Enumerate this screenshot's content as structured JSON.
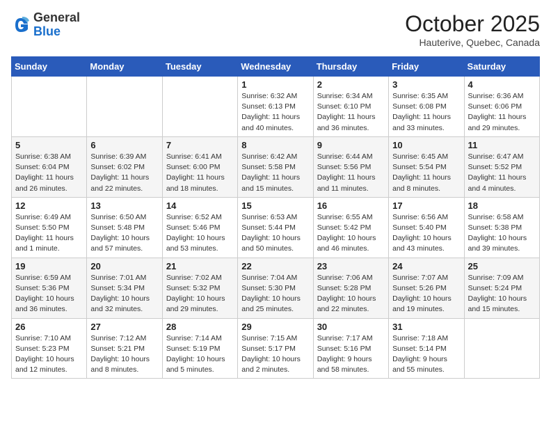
{
  "header": {
    "logo_general": "General",
    "logo_blue": "Blue",
    "month": "October 2025",
    "location": "Hauterive, Quebec, Canada"
  },
  "weekdays": [
    "Sunday",
    "Monday",
    "Tuesday",
    "Wednesday",
    "Thursday",
    "Friday",
    "Saturday"
  ],
  "weeks": [
    [
      {
        "day": "",
        "info": ""
      },
      {
        "day": "",
        "info": ""
      },
      {
        "day": "",
        "info": ""
      },
      {
        "day": "1",
        "info": "Sunrise: 6:32 AM\nSunset: 6:13 PM\nDaylight: 11 hours\nand 40 minutes."
      },
      {
        "day": "2",
        "info": "Sunrise: 6:34 AM\nSunset: 6:10 PM\nDaylight: 11 hours\nand 36 minutes."
      },
      {
        "day": "3",
        "info": "Sunrise: 6:35 AM\nSunset: 6:08 PM\nDaylight: 11 hours\nand 33 minutes."
      },
      {
        "day": "4",
        "info": "Sunrise: 6:36 AM\nSunset: 6:06 PM\nDaylight: 11 hours\nand 29 minutes."
      }
    ],
    [
      {
        "day": "5",
        "info": "Sunrise: 6:38 AM\nSunset: 6:04 PM\nDaylight: 11 hours\nand 26 minutes."
      },
      {
        "day": "6",
        "info": "Sunrise: 6:39 AM\nSunset: 6:02 PM\nDaylight: 11 hours\nand 22 minutes."
      },
      {
        "day": "7",
        "info": "Sunrise: 6:41 AM\nSunset: 6:00 PM\nDaylight: 11 hours\nand 18 minutes."
      },
      {
        "day": "8",
        "info": "Sunrise: 6:42 AM\nSunset: 5:58 PM\nDaylight: 11 hours\nand 15 minutes."
      },
      {
        "day": "9",
        "info": "Sunrise: 6:44 AM\nSunset: 5:56 PM\nDaylight: 11 hours\nand 11 minutes."
      },
      {
        "day": "10",
        "info": "Sunrise: 6:45 AM\nSunset: 5:54 PM\nDaylight: 11 hours\nand 8 minutes."
      },
      {
        "day": "11",
        "info": "Sunrise: 6:47 AM\nSunset: 5:52 PM\nDaylight: 11 hours\nand 4 minutes."
      }
    ],
    [
      {
        "day": "12",
        "info": "Sunrise: 6:49 AM\nSunset: 5:50 PM\nDaylight: 11 hours\nand 1 minute."
      },
      {
        "day": "13",
        "info": "Sunrise: 6:50 AM\nSunset: 5:48 PM\nDaylight: 10 hours\nand 57 minutes."
      },
      {
        "day": "14",
        "info": "Sunrise: 6:52 AM\nSunset: 5:46 PM\nDaylight: 10 hours\nand 53 minutes."
      },
      {
        "day": "15",
        "info": "Sunrise: 6:53 AM\nSunset: 5:44 PM\nDaylight: 10 hours\nand 50 minutes."
      },
      {
        "day": "16",
        "info": "Sunrise: 6:55 AM\nSunset: 5:42 PM\nDaylight: 10 hours\nand 46 minutes."
      },
      {
        "day": "17",
        "info": "Sunrise: 6:56 AM\nSunset: 5:40 PM\nDaylight: 10 hours\nand 43 minutes."
      },
      {
        "day": "18",
        "info": "Sunrise: 6:58 AM\nSunset: 5:38 PM\nDaylight: 10 hours\nand 39 minutes."
      }
    ],
    [
      {
        "day": "19",
        "info": "Sunrise: 6:59 AM\nSunset: 5:36 PM\nDaylight: 10 hours\nand 36 minutes."
      },
      {
        "day": "20",
        "info": "Sunrise: 7:01 AM\nSunset: 5:34 PM\nDaylight: 10 hours\nand 32 minutes."
      },
      {
        "day": "21",
        "info": "Sunrise: 7:02 AM\nSunset: 5:32 PM\nDaylight: 10 hours\nand 29 minutes."
      },
      {
        "day": "22",
        "info": "Sunrise: 7:04 AM\nSunset: 5:30 PM\nDaylight: 10 hours\nand 25 minutes."
      },
      {
        "day": "23",
        "info": "Sunrise: 7:06 AM\nSunset: 5:28 PM\nDaylight: 10 hours\nand 22 minutes."
      },
      {
        "day": "24",
        "info": "Sunrise: 7:07 AM\nSunset: 5:26 PM\nDaylight: 10 hours\nand 19 minutes."
      },
      {
        "day": "25",
        "info": "Sunrise: 7:09 AM\nSunset: 5:24 PM\nDaylight: 10 hours\nand 15 minutes."
      }
    ],
    [
      {
        "day": "26",
        "info": "Sunrise: 7:10 AM\nSunset: 5:23 PM\nDaylight: 10 hours\nand 12 minutes."
      },
      {
        "day": "27",
        "info": "Sunrise: 7:12 AM\nSunset: 5:21 PM\nDaylight: 10 hours\nand 8 minutes."
      },
      {
        "day": "28",
        "info": "Sunrise: 7:14 AM\nSunset: 5:19 PM\nDaylight: 10 hours\nand 5 minutes."
      },
      {
        "day": "29",
        "info": "Sunrise: 7:15 AM\nSunset: 5:17 PM\nDaylight: 10 hours\nand 2 minutes."
      },
      {
        "day": "30",
        "info": "Sunrise: 7:17 AM\nSunset: 5:16 PM\nDaylight: 9 hours\nand 58 minutes."
      },
      {
        "day": "31",
        "info": "Sunrise: 7:18 AM\nSunset: 5:14 PM\nDaylight: 9 hours\nand 55 minutes."
      },
      {
        "day": "",
        "info": ""
      }
    ]
  ]
}
